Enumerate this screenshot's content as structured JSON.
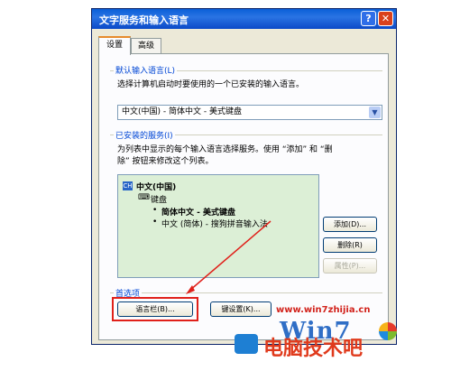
{
  "window": {
    "title": "文字服务和输入语言",
    "help_label": "?",
    "close_label": "✕"
  },
  "tabs": [
    {
      "label": "设置"
    },
    {
      "label": "高级"
    }
  ],
  "default_language": {
    "group_label": "默认输入语言(L)",
    "description": "选择计算机启动时要使用的一个已安装的输入语言。",
    "selected": "中文(中国) - 简体中文 - 美式键盘"
  },
  "installed_services": {
    "group_label": "已安装的服务(I)",
    "description_line1": "为列表中显示的每个输入语言选择服务。使用 “添加” 和 “删",
    "description_line2": "除” 按钮来修改这个列表。",
    "tree": {
      "language": "中文(中国)",
      "category": "键盘",
      "items": [
        "简体中文 - 美式键盘",
        "中文 (简体) - 搜狗拼音输入法"
      ]
    },
    "add_label": "添加(D)...",
    "remove_label": "删除(R)",
    "properties_label": "属性(P)..."
  },
  "preferences": {
    "group_label": "首选项",
    "language_bar_label": "语言栏(B)...",
    "key_settings_label": "键设置(K)..."
  },
  "watermark": {
    "url": "www.win7zhijia.cn",
    "logo_text": "Win7",
    "brand": "电脑技术吧"
  },
  "colors": {
    "title_bar": "#0b52d4",
    "dialog_bg": "#ece9d8",
    "highlight_box": "#e0201a",
    "arrow": "#e0201a",
    "group_label": "#0046d5"
  }
}
